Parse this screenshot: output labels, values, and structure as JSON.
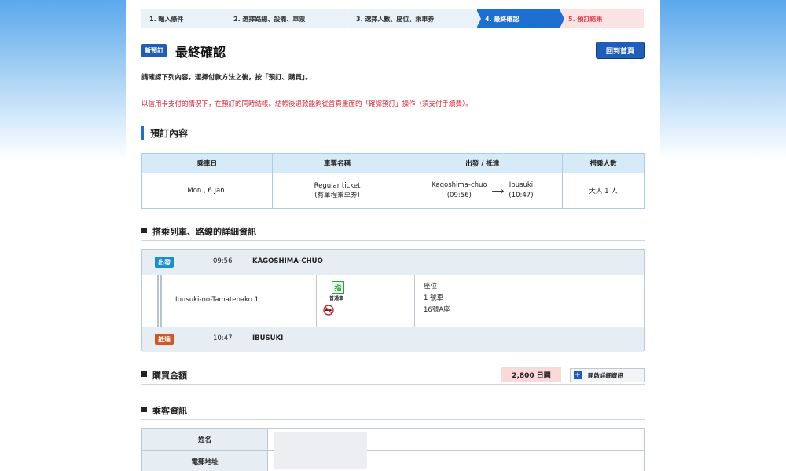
{
  "steps": [
    {
      "label": "1.  輸入條件",
      "state": "done"
    },
    {
      "label": "2.  選擇路線、設備、車票",
      "state": "done"
    },
    {
      "label": "3.  選擇人數、座位、乘車券",
      "state": "done"
    },
    {
      "label": "4.  最終確認",
      "state": "active"
    },
    {
      "label": "5.  預訂結果",
      "state": "result"
    }
  ],
  "header": {
    "badge": "新預訂",
    "title": "最終確認",
    "home_button": "回到首頁"
  },
  "instruction": "請確認下列內容，選擇付款方法之後，按「預訂、購買」。",
  "warning": "以信用卡支付的情況下，在預訂的同時結帳。結帳後退款能夠從首頁畫面的「確認預訂」操作（須支付手續費）。",
  "reservation": {
    "section_title": "預訂內容",
    "headers": [
      "乘車日",
      "車票名稱",
      "出發 / 抵達",
      "搭乘人數"
    ],
    "date": "Mon., 6 Jan.",
    "ticket_name_line1": "Regular ticket",
    "ticket_name_line2": "(有單程乘車券)",
    "from_station": "Kagoshima-chuo",
    "from_time": "(09:56)",
    "arrow": "⟶",
    "to_station": "Ibusuki",
    "to_time": "(10:47)",
    "passengers": "大人 1 人"
  },
  "train_details": {
    "section_title": "搭乘列車、路線的詳細資訊",
    "departure": {
      "tag": "出發",
      "time": "09:56",
      "station": "KAGOSHIMA-CHUO"
    },
    "train_name": "Ibusuki-no-Tamatebako 1",
    "reserved_icon": "指",
    "train_type": "普通車",
    "seat_label": "座位",
    "car": "1 號車",
    "seat": "16號A座",
    "arrival": {
      "tag": "抵達",
      "time": "10:47",
      "station": "IBUSUKI"
    }
  },
  "purchase": {
    "section_title": "購買金額",
    "amount": "2,800  日圓",
    "detail_button": "開啟詳細資訊"
  },
  "passenger_info": {
    "section_title": "乘客資訊",
    "name_label": "姓名",
    "email_label": "電郵地址"
  }
}
